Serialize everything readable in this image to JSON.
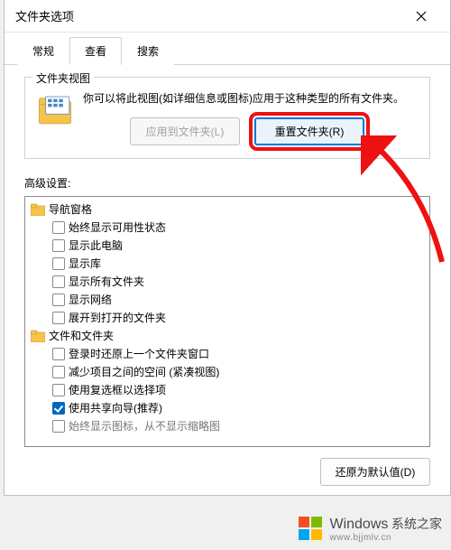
{
  "titlebar": {
    "title": "文件夹选项"
  },
  "tabs": {
    "general": "常规",
    "view": "查看",
    "search": "搜索"
  },
  "viewPanel": {
    "groupTitle": "文件夹视图",
    "groupDesc": "你可以将此视图(如详细信息或图标)应用于这种类型的所有文件夹。",
    "applyBtn": "应用到文件夹(L)",
    "resetBtn": "重置文件夹(R)",
    "advLabel": "高级设置:",
    "restoreDefaultsBtn": "还原为默认值(D)",
    "tree": {
      "navPane": "导航窗格",
      "items1": [
        "始终显示可用性状态",
        "显示此电脑",
        "显示库",
        "显示所有文件夹",
        "显示网络",
        "展开到打开的文件夹"
      ],
      "filesFolders": "文件和文件夹",
      "items2": [
        {
          "label": "登录时还原上一个文件夹窗口",
          "checked": false
        },
        {
          "label": "减少项目之间的空间 (紧凑视图)",
          "checked": false
        },
        {
          "label": "使用复选框以选择项",
          "checked": false
        },
        {
          "label": "使用共享向导(推荐)",
          "checked": true
        },
        {
          "label": "始终显示图标，从不显示缩略图",
          "checked": false
        }
      ]
    }
  },
  "watermark": {
    "brand": "Windows",
    "sub": "系统之家",
    "url": "www.bjjmlv.cn"
  }
}
